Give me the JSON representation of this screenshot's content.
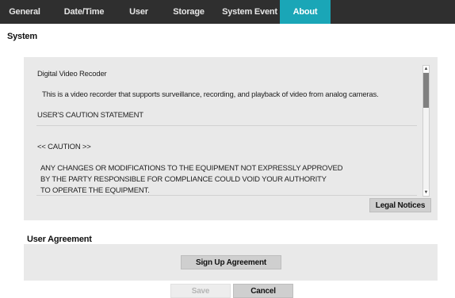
{
  "tabs": [
    {
      "label": "General",
      "active": false
    },
    {
      "label": "Date/Time",
      "active": false
    },
    {
      "label": "User",
      "active": false
    },
    {
      "label": "Storage",
      "active": false
    },
    {
      "label": "System Event",
      "active": false
    },
    {
      "label": "About",
      "active": true
    }
  ],
  "system": {
    "title": "System",
    "text_lines": [
      "Digital Video Recoder",
      "This is a video recorder that supports surveillance, recording, and playback of video from analog cameras.",
      "USER'S CAUTION STATEMENT",
      "<< CAUTION >>",
      "ANY CHANGES OR MODIFICATIONS TO THE EQUIPMENT NOT EXPRESSLY APPROVED",
      "BY THE PARTY RESPONSIBLE FOR COMPLIANCE COULD VOID YOUR AUTHORITY",
      "TO OPERATE THE EQUIPMENT."
    ],
    "legal_notices_label": "Legal Notices"
  },
  "user_agreement": {
    "title": "User Agreement",
    "sign_up_label": "Sign Up Agreement"
  },
  "footer": {
    "save_label": "Save",
    "cancel_label": "Cancel"
  },
  "colors": {
    "tabbar": "#2f2f2f",
    "active_tab": "#1aa6b7",
    "panel": "#e9e9e9"
  }
}
